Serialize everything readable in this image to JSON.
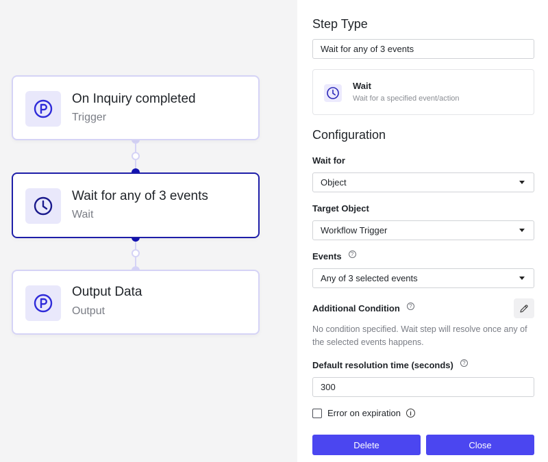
{
  "canvas": {
    "nodes": [
      {
        "title": "On Inquiry completed",
        "subtitle": "Trigger",
        "icon": "p-circle-icon"
      },
      {
        "title": "Wait for any of 3 events",
        "subtitle": "Wait",
        "icon": "clock-icon"
      },
      {
        "title": "Output Data",
        "subtitle": "Output",
        "icon": "p-circle-icon"
      }
    ]
  },
  "panel": {
    "step_type_heading": "Step Type",
    "step_name_value": "Wait for any of 3 events",
    "type_card": {
      "title": "Wait",
      "description": "Wait for a specified event/action"
    },
    "configuration_heading": "Configuration",
    "wait_for": {
      "label": "Wait for",
      "value": "Object"
    },
    "target_object": {
      "label": "Target Object",
      "value": "Workflow Trigger"
    },
    "events": {
      "label": "Events",
      "value": "Any of 3 selected events"
    },
    "additional_condition": {
      "label": "Additional Condition",
      "note": "No condition specified. Wait step will resolve once any of the selected events happens."
    },
    "resolution_time": {
      "label": "Default resolution time (seconds)",
      "value": "300"
    },
    "error_on_expiration": {
      "label": "Error on expiration",
      "checked": false
    },
    "delete_label": "Delete",
    "close_label": "Close"
  },
  "colors": {
    "accent": "#4b46f0",
    "selected_border": "#1e1ea8",
    "node_border": "#d5d3f6"
  }
}
